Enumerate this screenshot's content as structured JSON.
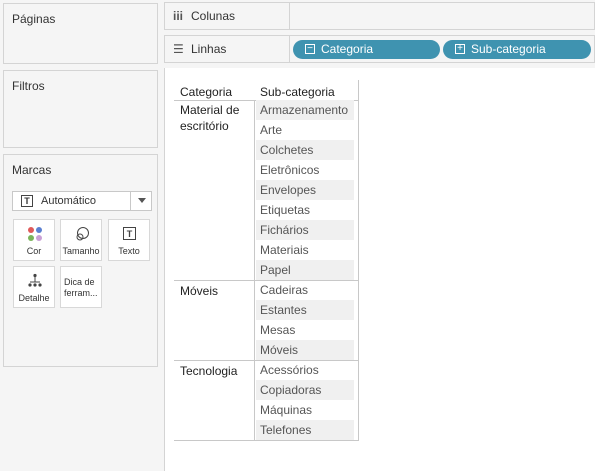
{
  "left": {
    "pages_title": "Páginas",
    "filters_title": "Filtros",
    "marks_title": "Marcas",
    "mark_type": "Automático",
    "mark_type_icon": "text-t-icon",
    "buttons": {
      "color": "Cor",
      "size": "Tamanho",
      "text": "Texto",
      "detail": "Detalhe",
      "tooltip": "Dica de ferram..."
    }
  },
  "shelves": {
    "columns_label": "Colunas",
    "rows_label": "Linhas",
    "row_pills": [
      "Categoria",
      "Sub-categoria"
    ],
    "pill_color": "#3f93b0"
  },
  "table": {
    "headers": [
      "Categoria",
      "Sub-categoria"
    ],
    "groups": [
      {
        "category": "Material de escritório",
        "items": [
          "Armazenamento",
          "Arte",
          "Colchetes",
          "Eletrônicos",
          "Envelopes",
          "Etiquetas",
          "Fichários",
          "Materiais",
          "Papel"
        ]
      },
      {
        "category": "Móveis",
        "items": [
          "Cadeiras",
          "Estantes",
          "Mesas",
          "Móveis"
        ]
      },
      {
        "category": "Tecnologia",
        "items": [
          "Acessórios",
          "Copiadoras",
          "Máquinas",
          "Telefones"
        ]
      }
    ]
  }
}
